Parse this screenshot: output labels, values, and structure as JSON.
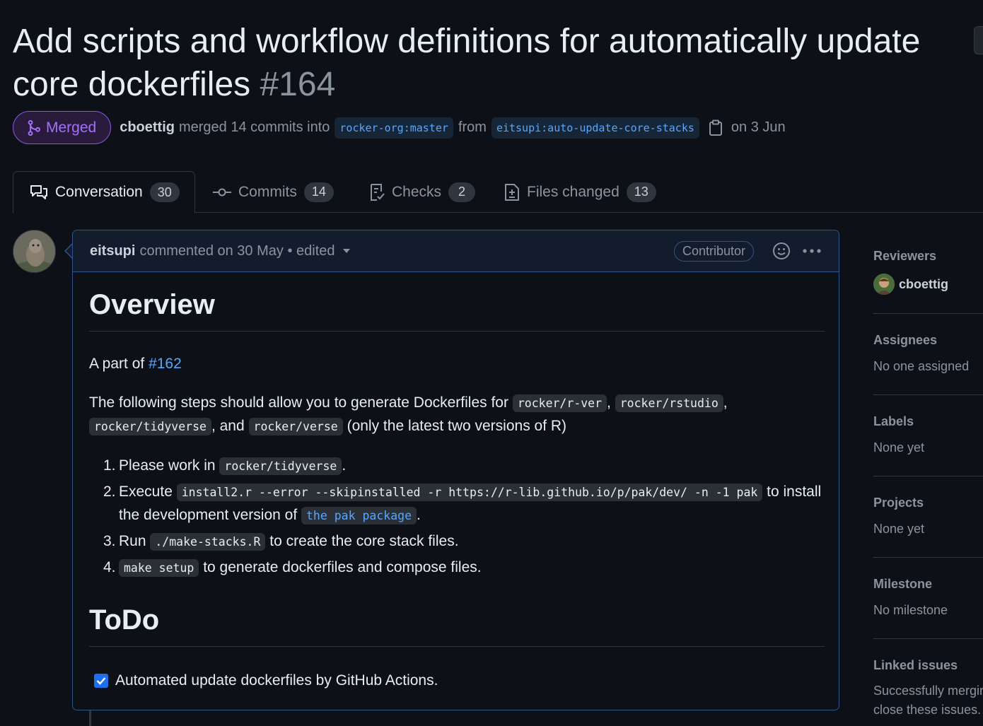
{
  "pr": {
    "title": "Add scripts and workflow definitions for automatically update core dockerfiles",
    "number": "#164",
    "state": "Merged",
    "author": "cboettig",
    "merged_text": "merged 14 commits into",
    "base_branch": "rocker-org:master",
    "from_text": "from",
    "head_branch": "eitsupi:auto-update-core-stacks",
    "date_text": "on 3 Jun"
  },
  "tabs": [
    {
      "label": "Conversation",
      "count": "30",
      "icon": "comment-discussion-icon"
    },
    {
      "label": "Commits",
      "count": "14",
      "icon": "git-commit-icon"
    },
    {
      "label": "Checks",
      "count": "2",
      "icon": "checklist-icon"
    },
    {
      "label": "Files changed",
      "count": "13",
      "icon": "file-diff-icon"
    }
  ],
  "comment": {
    "author": "eitsupi",
    "meta": "commented on 30 May • edited",
    "badge": "Contributor",
    "heading_overview": "Overview",
    "part_of_prefix": "A part of",
    "part_of_link": "#162",
    "steps_intro": "The following steps should allow you to generate Dockerfiles for",
    "img_rver": "rocker/r-ver",
    "img_rstudio": "rocker/rstudio",
    "img_tidyverse": "rocker/tidyverse",
    "and_text": ", and",
    "img_verse": "rocker/verse",
    "steps_suffix": "(only the latest two versions of R)",
    "list": {
      "item1_text": "Please work in",
      "item1_code": "rocker/tidyverse",
      "item2_text": "Execute",
      "item2_code": "install2.r --error --skipinstalled -r https://r-lib.github.io/p/pak/dev/ -n -1 pak",
      "item2_suffix": "to install",
      "item2_line2": "the development version of",
      "item2_link": "the pak package",
      "item3_text": "Run",
      "item3_code": "./make-stacks.R",
      "item3_suffix": "to create the core stack files.",
      "item4_code": "make setup",
      "item4_suffix": "to generate dockerfiles and compose files."
    },
    "heading_todo": "ToDo",
    "todo_item": "Automated update dockerfiles by GitHub Actions.",
    "todo_checked": true
  },
  "sidebar": {
    "reviewers_label": "Reviewers",
    "reviewer": "cboettig",
    "assignees_label": "Assignees",
    "assignees_value": "No one assigned",
    "labels_label": "Labels",
    "labels_value": "None yet",
    "projects_label": "Projects",
    "projects_value": "None yet",
    "milestone_label": "Milestone",
    "milestone_value": "No milestone",
    "linked_label": "Linked issues",
    "linked_value_line1": "Successfully merging",
    "linked_value_line2": "close these issues."
  },
  "colors": {
    "merged": "#a371f7",
    "link": "#58a6ff",
    "checkbox": "#1f6feb",
    "comment_border": "#2f548c"
  }
}
